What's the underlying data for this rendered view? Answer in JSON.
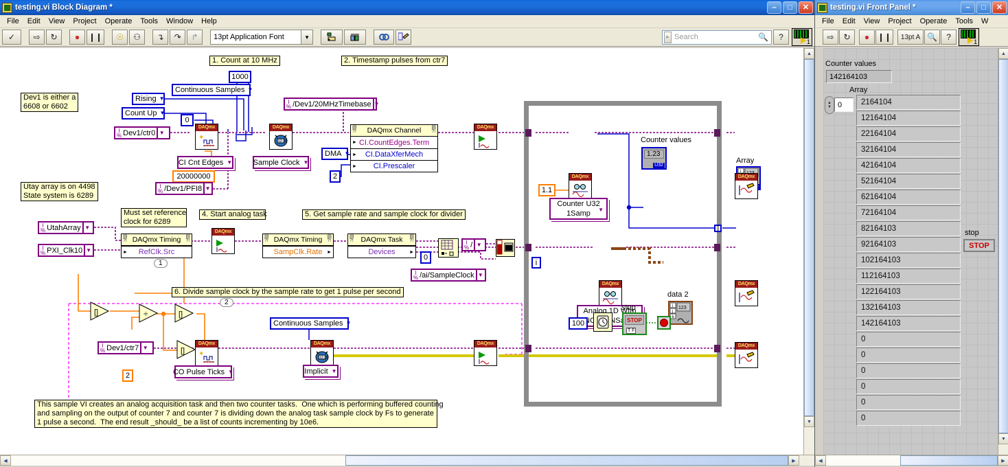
{
  "block_diagram_window": {
    "title": "testing.vi Block Diagram *",
    "window_buttons": {
      "minimize": "–",
      "maximize": "□",
      "close": "✕"
    },
    "menus": [
      "File",
      "Edit",
      "View",
      "Project",
      "Operate",
      "Tools",
      "Window",
      "Help"
    ],
    "toolbar": {
      "run_check": "✓",
      "run": "⇨",
      "run_continuous": "↻",
      "abort": "●",
      "pause": "❙❙",
      "highlight": "☉",
      "retain_wire_values": "⚇",
      "step_into": "↴",
      "step_over": "↷",
      "step_out": "↱",
      "font": "13pt Application Font",
      "align_objects": "align-icon",
      "distribute_objects": "distribute-icon",
      "reorder": "reorder-icon",
      "clean_up_diagram": "cleanup-icon"
    },
    "search": {
      "placeholder": "Search",
      "icon": "search-icon",
      "help": "?"
    },
    "vi_icon_number": "1"
  },
  "front_panel_window": {
    "title": "testing.vi Front Panel *",
    "window_buttons": {
      "minimize": "–",
      "maximize": "□",
      "close": "✕"
    },
    "menus": [
      "File",
      "Edit",
      "View",
      "Project",
      "Operate",
      "Tools",
      "W"
    ],
    "toolbar": {
      "font": "13pt A",
      "search": "search-icon",
      "help": "?"
    },
    "vi_icon_number": "1",
    "counter_values_label": "Counter values",
    "counter_values_value": "142164103",
    "array_label": "Array",
    "array_index": "0",
    "array_values": [
      "2164104",
      "12164104",
      "22164104",
      "32164104",
      "42164104",
      "52164104",
      "62164104",
      "72164104",
      "82164103",
      "92164103",
      "102164103",
      "112164103",
      "122164103",
      "132164103",
      "142164103",
      "0",
      "0",
      "0",
      "0",
      "0",
      "0"
    ],
    "stop_label": "stop",
    "stop_button": "STOP"
  },
  "diagram": {
    "comments": {
      "step1": "1. Count at 10 MHz",
      "step2": "2. Timestamp pulses from ctr7",
      "step4": "4. Start analog task",
      "step5": "5. Get sample rate and sample clock for divider",
      "step6": "6. Divide sample clock by the sample rate to get 1 pulse per second",
      "dev1_note": "Dev1 is either a\n6608 or 6602",
      "utah_note": "Utay array is on 4498\nState system is 6289",
      "refclk_note": "Must set reference\nclock for 6289",
      "description": "This sample VI creates an analog acquisition task and then two counter tasks.  One which is performing buffered counting\nand sampling on the output of counter 7 and counter 7 is dividing down the analog task sample clock by Fs to generate\n1 pulse a second.  The end result _should_ be a list of counts incrementing by 10e6."
    },
    "controls": {
      "continuous_samples_top": "Continuous Samples",
      "continuous_samples_bottom": "Continuous Samples",
      "const_1000": "1000",
      "rising": "Rising",
      "count_up": "Count Up",
      "const_0_a": "0",
      "const_0_b": "0",
      "const_2_dma": "2",
      "const_2_div": "2",
      "const_2_sub": "2",
      "const_20000000": "20000000",
      "const_1_1": "1.1",
      "const_100": "100",
      "dev1_ctr0": "Dev1/ctr0",
      "dev1_ctr7": "Dev1/ctr7",
      "dev1_pfi8": "/Dev1/PFI8",
      "dev1_20mhz": "/Dev1/20MHzTimebase",
      "utah_array": "UtahArray",
      "pxi_clk10": "PXI_Clk10",
      "ai_sample_clock": "/ai/SampleClock",
      "slash": "/",
      "ci_cnt_edges": "CI Cnt Edges",
      "sample_clock": "Sample Clock",
      "dma": "DMA",
      "co_pulse_ticks": "CO Pulse Ticks",
      "implicit": "Implicit",
      "counter_u32_1samp": "Counter U32\n1Samp",
      "analog_1d_wfm": "Analog 1D Wfm\nNChan NSamp"
    },
    "property_nodes": {
      "daqmx_channel": {
        "header": "DAQmx Channel",
        "rows": [
          "CI.CountEdges.Term",
          "CI.DataXferMech",
          "CI.Prescaler"
        ]
      },
      "daqmx_timing_refclk": {
        "header": "DAQmx Timing",
        "rows": [
          "RefClk.Src"
        ]
      },
      "daqmx_timing_sampclk": {
        "header": "DAQmx Timing",
        "rows": [
          "SampClk.Rate"
        ]
      },
      "daqmx_task_devices": {
        "header": "DAQmx Task",
        "rows": [
          "Devices"
        ]
      }
    },
    "indicators": {
      "counter_values_label": "Counter values",
      "counter_values_value": "1.23",
      "counter_values_type": "U32",
      "array_label": "Array",
      "array_type": "U32",
      "array_value": "123",
      "data2_label": "data 2",
      "data2_value": "123",
      "stop_label": "stop",
      "stop_button": "STOP",
      "stop_tf": "T F",
      "iterator": "i"
    },
    "subdiagram_labels": {
      "one": "1",
      "two": "2"
    },
    "colors": {
      "daqmx_red": "#9b1b1b",
      "wire_purple": "#800080",
      "wire_blue": "#0000cc",
      "wire_orange": "#ff7f00",
      "wire_magenta": "#ff66ff",
      "comment_yellow": "#ffffcc",
      "loop_gray": "#8c8c8c"
    }
  }
}
